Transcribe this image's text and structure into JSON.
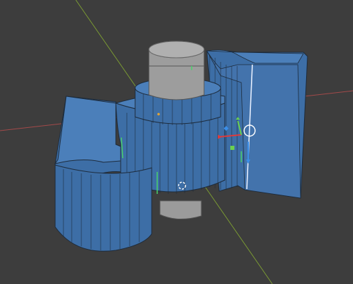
{
  "viewport": {
    "background": "#3d3d3d",
    "mode": "edit-mode",
    "selection": "face-selected"
  },
  "colors": {
    "face_fill": "#3d6ea6",
    "face_fill_dark": "#2e5b8c",
    "face_fill_light": "#4b7fba",
    "edge_line": "#1d2b3b",
    "unselected_face": "#9b9b9b",
    "x_axis": "#a54a4a",
    "y_axis": "#7a9a33",
    "gizmo_x": "#e03a3a",
    "gizmo_y": "#6bd04f",
    "gizmo_z": "#3b8ee8",
    "edge_highlight": "#e8f0ff",
    "normal_marker": "#4bd26a"
  },
  "icons": {
    "transform_gizmo": "move-gizmo-icon",
    "cursor_3d": "3d-cursor-icon"
  }
}
